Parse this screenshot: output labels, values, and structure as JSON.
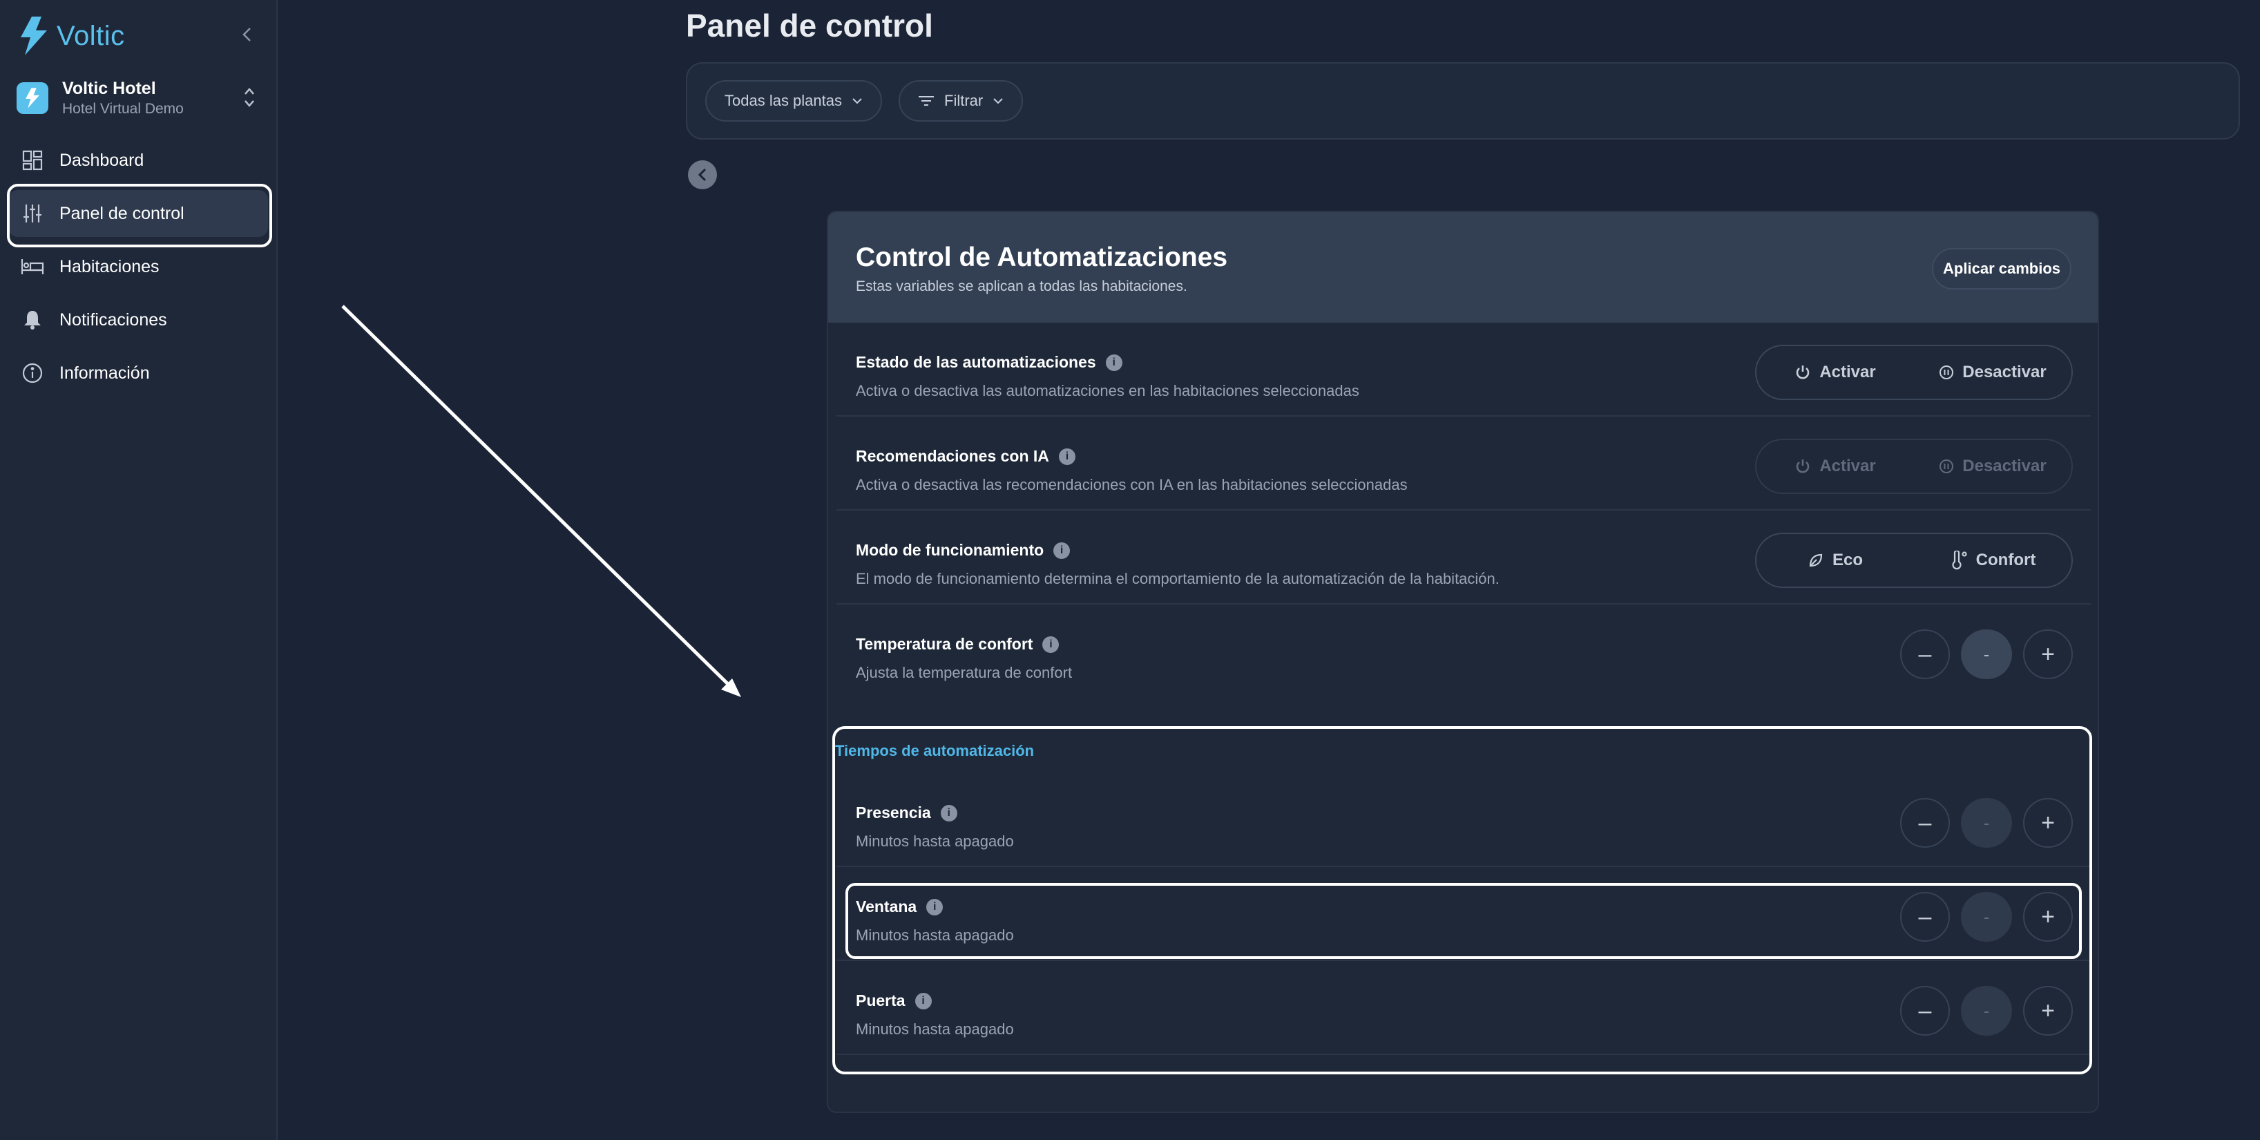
{
  "brand": {
    "name": "Voltic",
    "accent": "#5ac0ec"
  },
  "hotel": {
    "name": "Voltic Hotel",
    "subtitle": "Hotel Virtual Demo"
  },
  "nav": {
    "items": [
      {
        "label": "Dashboard",
        "icon": "dashboard-icon"
      },
      {
        "label": "Panel de control",
        "icon": "sliders-icon",
        "active": true
      },
      {
        "label": "Habitaciones",
        "icon": "bed-icon"
      },
      {
        "label": "Notificaciones",
        "icon": "bell-icon"
      },
      {
        "label": "Información",
        "icon": "info-circle-icon"
      }
    ]
  },
  "page": {
    "title": "Panel de control"
  },
  "filters": {
    "floors": "Todas las plantas",
    "filter": "Filtrar"
  },
  "card": {
    "title": "Control de Automatizaciones",
    "subtitle": "Estas variables se aplican a todas las habitaciones.",
    "apply": "Aplicar cambios"
  },
  "rows": {
    "automations": {
      "label": "Estado de las automatizaciones",
      "desc": "Activa o desactiva las automatizaciones en las habitaciones seleccionadas",
      "on": "Activar",
      "off": "Desactivar"
    },
    "ai": {
      "label": "Recomendaciones con IA",
      "desc": "Activa o desactiva las recomendaciones con IA en las habitaciones seleccionadas",
      "on": "Activar",
      "off": "Desactivar"
    },
    "mode": {
      "label": "Modo de funcionamiento",
      "desc": "El modo de funcionamiento determina el comportamiento de la automatización de la habitación.",
      "eco": "Eco",
      "comfort": "Confort"
    },
    "comfort_temp": {
      "label": "Temperatura de confort",
      "desc": "Ajusta la temperatura de confort",
      "value": "-"
    }
  },
  "timers": {
    "section": "Tiempos de automatización",
    "presence": {
      "label": "Presencia",
      "desc": "Minutos hasta apagado",
      "value": "-"
    },
    "window": {
      "label": "Ventana",
      "desc": "Minutos hasta apagado",
      "value": "-"
    },
    "door": {
      "label": "Puerta",
      "desc": "Minutos hasta apagado",
      "value": "-"
    }
  },
  "info_glyph": "i",
  "minus_glyph": "–",
  "plus_glyph": "+"
}
